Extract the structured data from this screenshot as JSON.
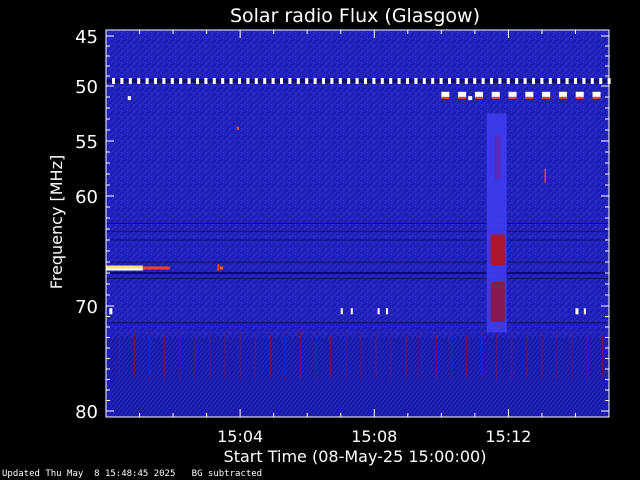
{
  "chart_data": {
    "type": "heatmap",
    "title": "Solar radio Flux (Glasgow)",
    "xlabel": "Start Time (08-May-25 15:00:00)",
    "ylabel": "Frequency [MHz]",
    "x_ticks": [
      "15:04",
      "15:08",
      "15:12"
    ],
    "y_ticks": [
      45,
      50,
      55,
      60,
      70,
      80
    ],
    "x_range_minutes": [
      15.0,
      15.0
    ],
    "features": [
      {
        "kind": "interference-line",
        "freq_mhz": 49.5
      },
      {
        "kind": "interference-line",
        "freq_mhz": 50.8
      },
      {
        "kind": "interference-line",
        "freq_mhz": 66.5
      },
      {
        "kind": "burst-column",
        "time": "15:11:40",
        "freq_mhz": [
          52.5,
          72.5
        ]
      }
    ],
    "colors": {
      "background": "#1a1ab0",
      "hot": "#ffffff",
      "warm": "#ff4020",
      "mid": "#c00000"
    }
  },
  "footer": {
    "updated": "Updated Thu May  8 15:48:45 2025",
    "note": "BG subtracted"
  }
}
